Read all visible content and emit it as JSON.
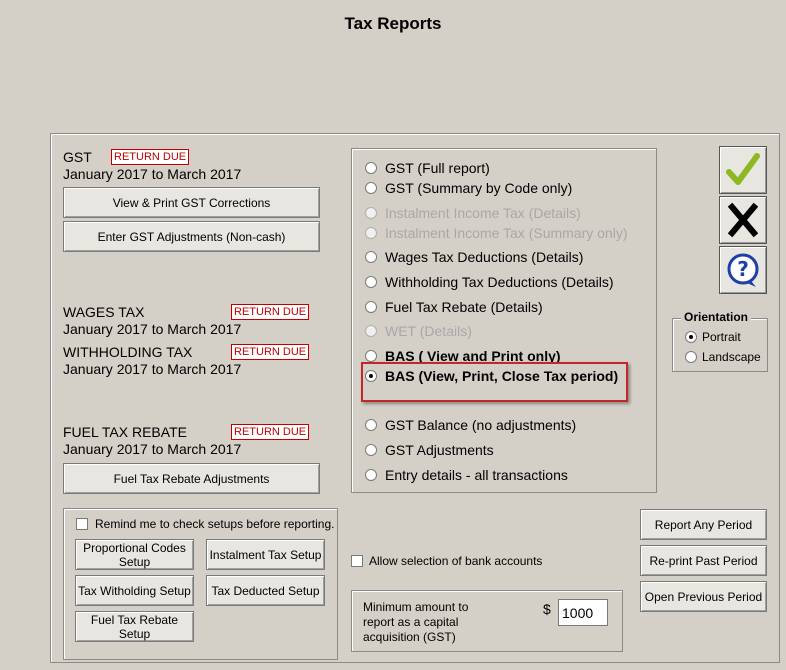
{
  "window": {
    "title": "Tax Reports"
  },
  "gst": {
    "label": "GST",
    "badge": "RETURN DUE",
    "period": "January 2017 to March 2017",
    "corrections_button": "View  & Print GST Corrections",
    "adjustments_button": "Enter GST Adjustments (Non-cash)"
  },
  "wages": {
    "label": "WAGES TAX",
    "badge": "RETURN DUE",
    "period": "January 2017 to March 2017"
  },
  "withholding": {
    "label": "WITHHOLDING TAX",
    "badge": "RETURN DUE",
    "period": "January 2017 to March 2017"
  },
  "fuel": {
    "label": "FUEL TAX REBATE",
    "badge": "RETURN DUE",
    "period": "January 2017 to March 2017",
    "adjustments_button": "Fuel Tax Rebate Adjustments"
  },
  "setup": {
    "remind_label": "Remind me to check setups before reporting.",
    "remind_checked": false,
    "buttons": {
      "proportional": "Proportional Codes Setup",
      "instalment": "Instalment Tax Setup",
      "tax_withholding": "Tax Witholding Setup",
      "tax_deducted": "Tax Deducted Setup",
      "fuel_rebate": "Fuel Tax Rebate Setup"
    }
  },
  "reports": {
    "options": [
      {
        "label": "GST (Full report)",
        "selected": false,
        "enabled": true,
        "bold": false
      },
      {
        "label": "GST (Summary by Code only)",
        "selected": false,
        "enabled": true,
        "bold": false
      },
      {
        "label": "Instalment Income Tax (Details)",
        "selected": false,
        "enabled": false,
        "bold": false
      },
      {
        "label": "Instalment Income Tax (Summary only)",
        "selected": false,
        "enabled": false,
        "bold": false
      },
      {
        "label": "Wages Tax Deductions (Details)",
        "selected": false,
        "enabled": true,
        "bold": false
      },
      {
        "label": "Withholding Tax Deductions (Details)",
        "selected": false,
        "enabled": true,
        "bold": false
      },
      {
        "label": "Fuel Tax Rebate (Details)",
        "selected": false,
        "enabled": true,
        "bold": false
      },
      {
        "label": "WET (Details)",
        "selected": false,
        "enabled": false,
        "bold": false
      },
      {
        "label": "BAS ( View and Print only)",
        "selected": false,
        "enabled": true,
        "bold": true
      },
      {
        "label": "BAS (View, Print, Close Tax period)",
        "selected": true,
        "enabled": true,
        "bold": true
      },
      {
        "label": "GST Balance (no adjustments)",
        "selected": false,
        "enabled": true,
        "bold": false
      },
      {
        "label": "GST Adjustments",
        "selected": false,
        "enabled": true,
        "bold": false
      },
      {
        "label": "Entry details - all transactions",
        "selected": false,
        "enabled": true,
        "bold": false
      }
    ]
  },
  "bank": {
    "label": "Allow selection of bank accounts",
    "checked": false
  },
  "capital": {
    "label": "Minimum amount to report as a capital acquisition (GST)",
    "currency": "$",
    "value": "1000"
  },
  "actions": {
    "ok_icon": "checkmark-icon",
    "close_icon": "close-x-icon",
    "help_icon": "help-icon",
    "ok_color": "#8db820"
  },
  "orientation": {
    "title": "Orientation",
    "portrait": "Portrait",
    "landscape": "Landscape",
    "selected": "Portrait"
  },
  "period_buttons": {
    "report_any": "Report Any Period",
    "reprint_past": "Re-print Past Period",
    "open_previous": "Open Previous Period"
  }
}
